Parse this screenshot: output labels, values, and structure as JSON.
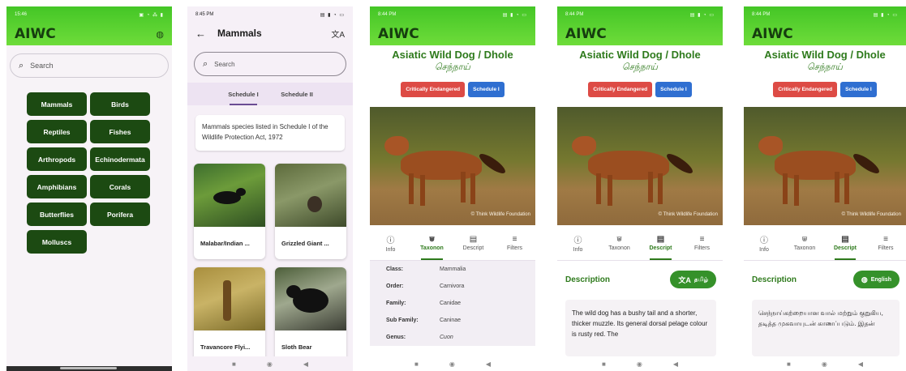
{
  "screen1": {
    "status": {
      "time": "15:46",
      "icons": "▣ ◔ ⁂ ▮"
    },
    "brand": "AIWC",
    "search_placeholder": "Search",
    "categories": [
      "Mammals",
      "Birds",
      "Reptiles",
      "Fishes",
      "Arthropods",
      "Echinodermata",
      "Amphibians",
      "Corals",
      "Butterflies",
      "Porifera",
      "Molluscs"
    ]
  },
  "screen2": {
    "status": {
      "time": "8:45 PM",
      "icons": "▤ ▮ ◔ ▭"
    },
    "title": "Mammals",
    "search_placeholder": "Search",
    "tabs": [
      "Schedule I",
      "Schedule II"
    ],
    "info": "Mammals species listed in Schedule I of the Wildlife Protection Act, 1972",
    "cards": [
      "Malabar/Indian ...",
      "Grizzled Giant ...",
      "Travancore Flyi...",
      "Sloth Bear"
    ]
  },
  "detail": {
    "status": {
      "time": "8:44 PM",
      "icons": "▤ ▮ ◔ ▭"
    },
    "brand": "AIWC",
    "name": "Asiatic Wild Dog / Dhole",
    "tamil_name": "செந்நாய்",
    "badge_status": "Critically Endangered",
    "badge_schedule": "Schedule I",
    "photo_credit": "© Think Wildlife Foundation",
    "tabs": [
      "Info",
      "Taxonon",
      "Descript",
      "Filters"
    ]
  },
  "taxonomy": [
    {
      "k": "Class:",
      "v": "Mammalia"
    },
    {
      "k": "Order:",
      "v": "Carnivora"
    },
    {
      "k": "Family:",
      "v": "Canidae"
    },
    {
      "k": "Sub Family:",
      "v": "Caninae"
    },
    {
      "k": "Genus:",
      "v": "Cuon"
    }
  ],
  "screen4": {
    "desc_title": "Description",
    "lang_button": "தமிழ்",
    "text": "The wild dog has a bushy tail and a shorter, thicker muzzle. Its general dorsal pelage colour is rusty red. The"
  },
  "screen5": {
    "desc_title": "Description",
    "lang_button": "English",
    "text": "செந்நாய்கற்றையான வால் மற்றும் குறுகிய, தடித்த முகவாயுடன் காணப்படும். இதன்"
  },
  "colors": {
    "brand_green": "#2e7a1c",
    "category_bg": "#1c4a12",
    "critical_red": "#dd4b45",
    "schedule_blue": "#2f6fd1"
  }
}
